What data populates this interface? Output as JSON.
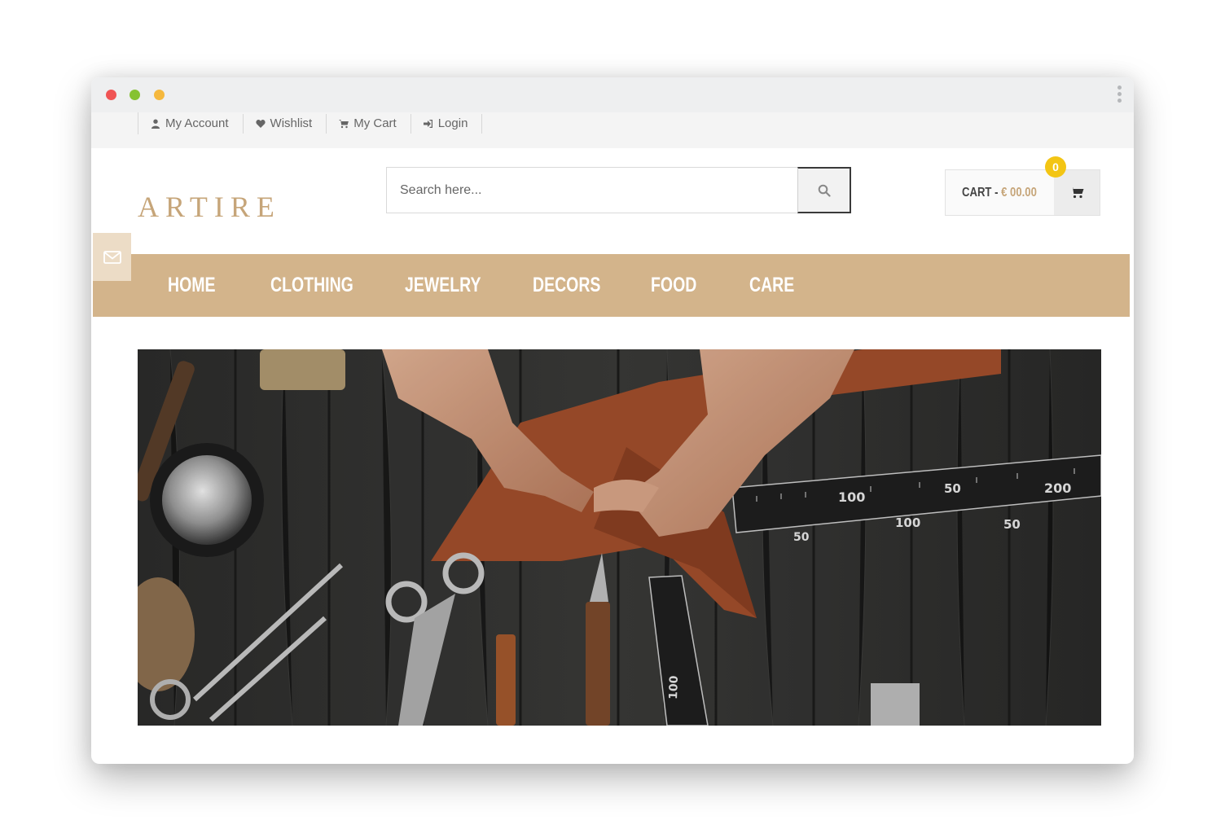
{
  "window": {
    "traffic_lights": [
      "red",
      "green",
      "yellow"
    ]
  },
  "topbar": {
    "links": [
      {
        "label": "My Account",
        "icon": "user-icon"
      },
      {
        "label": "Wishlist",
        "icon": "heart-icon"
      },
      {
        "label": "My Cart",
        "icon": "cart-icon"
      },
      {
        "label": "Login",
        "icon": "sign-in-icon"
      }
    ]
  },
  "header": {
    "logo": "ARTIRE",
    "search": {
      "placeholder": "Search here..."
    },
    "cart": {
      "label": "CART -",
      "amount": "€ 00.00",
      "count": "0"
    }
  },
  "nav": {
    "items": [
      "HOME",
      "CLOTHING",
      "JEWELRY",
      "DECORS",
      "FOOD",
      "CARE"
    ]
  },
  "hero": {
    "image": "leather-craftsman-hands-with-tools",
    "ruler_marks": [
      "100",
      "200",
      "50",
      "100",
      "50",
      "50",
      "100"
    ]
  },
  "colors": {
    "accent": "#d3b48b",
    "logo": "#c6a579",
    "badge": "#f3c514"
  }
}
